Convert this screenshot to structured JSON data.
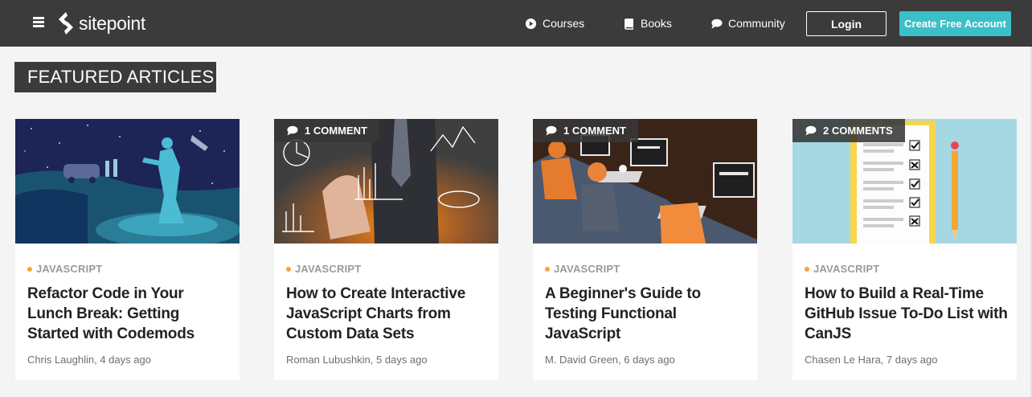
{
  "nav": {
    "logo_text": "sitepoint",
    "links": [
      {
        "label": "Courses",
        "icon": "play-circle-icon"
      },
      {
        "label": "Books",
        "icon": "book-icon"
      },
      {
        "label": "Community",
        "icon": "chat-bubble-icon"
      }
    ],
    "login_label": "Login",
    "create_label": "Create Free Account"
  },
  "section": {
    "heading": "FEATURED ARTICLES"
  },
  "articles": [
    {
      "comments": "",
      "category": "JAVASCRIPT",
      "title": "Refactor Code in Your Lunch Break: Getting Started with Codemods",
      "meta": "Chris Laughlin, 4 days ago"
    },
    {
      "comments": "1 COMMENT",
      "category": "JAVASCRIPT",
      "title": "How to Create Interactive JavaScript Charts from Custom Data Sets",
      "meta": "Roman Lubushkin, 5 days ago"
    },
    {
      "comments": "1 COMMENT",
      "category": "JAVASCRIPT",
      "title": "A Beginner's Guide to Testing Functional JavaScript",
      "meta": "M. David Green, 6 days ago"
    },
    {
      "comments": "2 COMMENTS",
      "category": "JAVASCRIPT",
      "title": "How to Build a Real-Time GitHub Issue To-Do List with CanJS",
      "meta": "Chasen Le Hara, 7 days ago"
    }
  ],
  "colors": {
    "nav_bg": "#3b3b3b",
    "accent": "#3bc0c8",
    "category_dot": "#f3a633"
  }
}
